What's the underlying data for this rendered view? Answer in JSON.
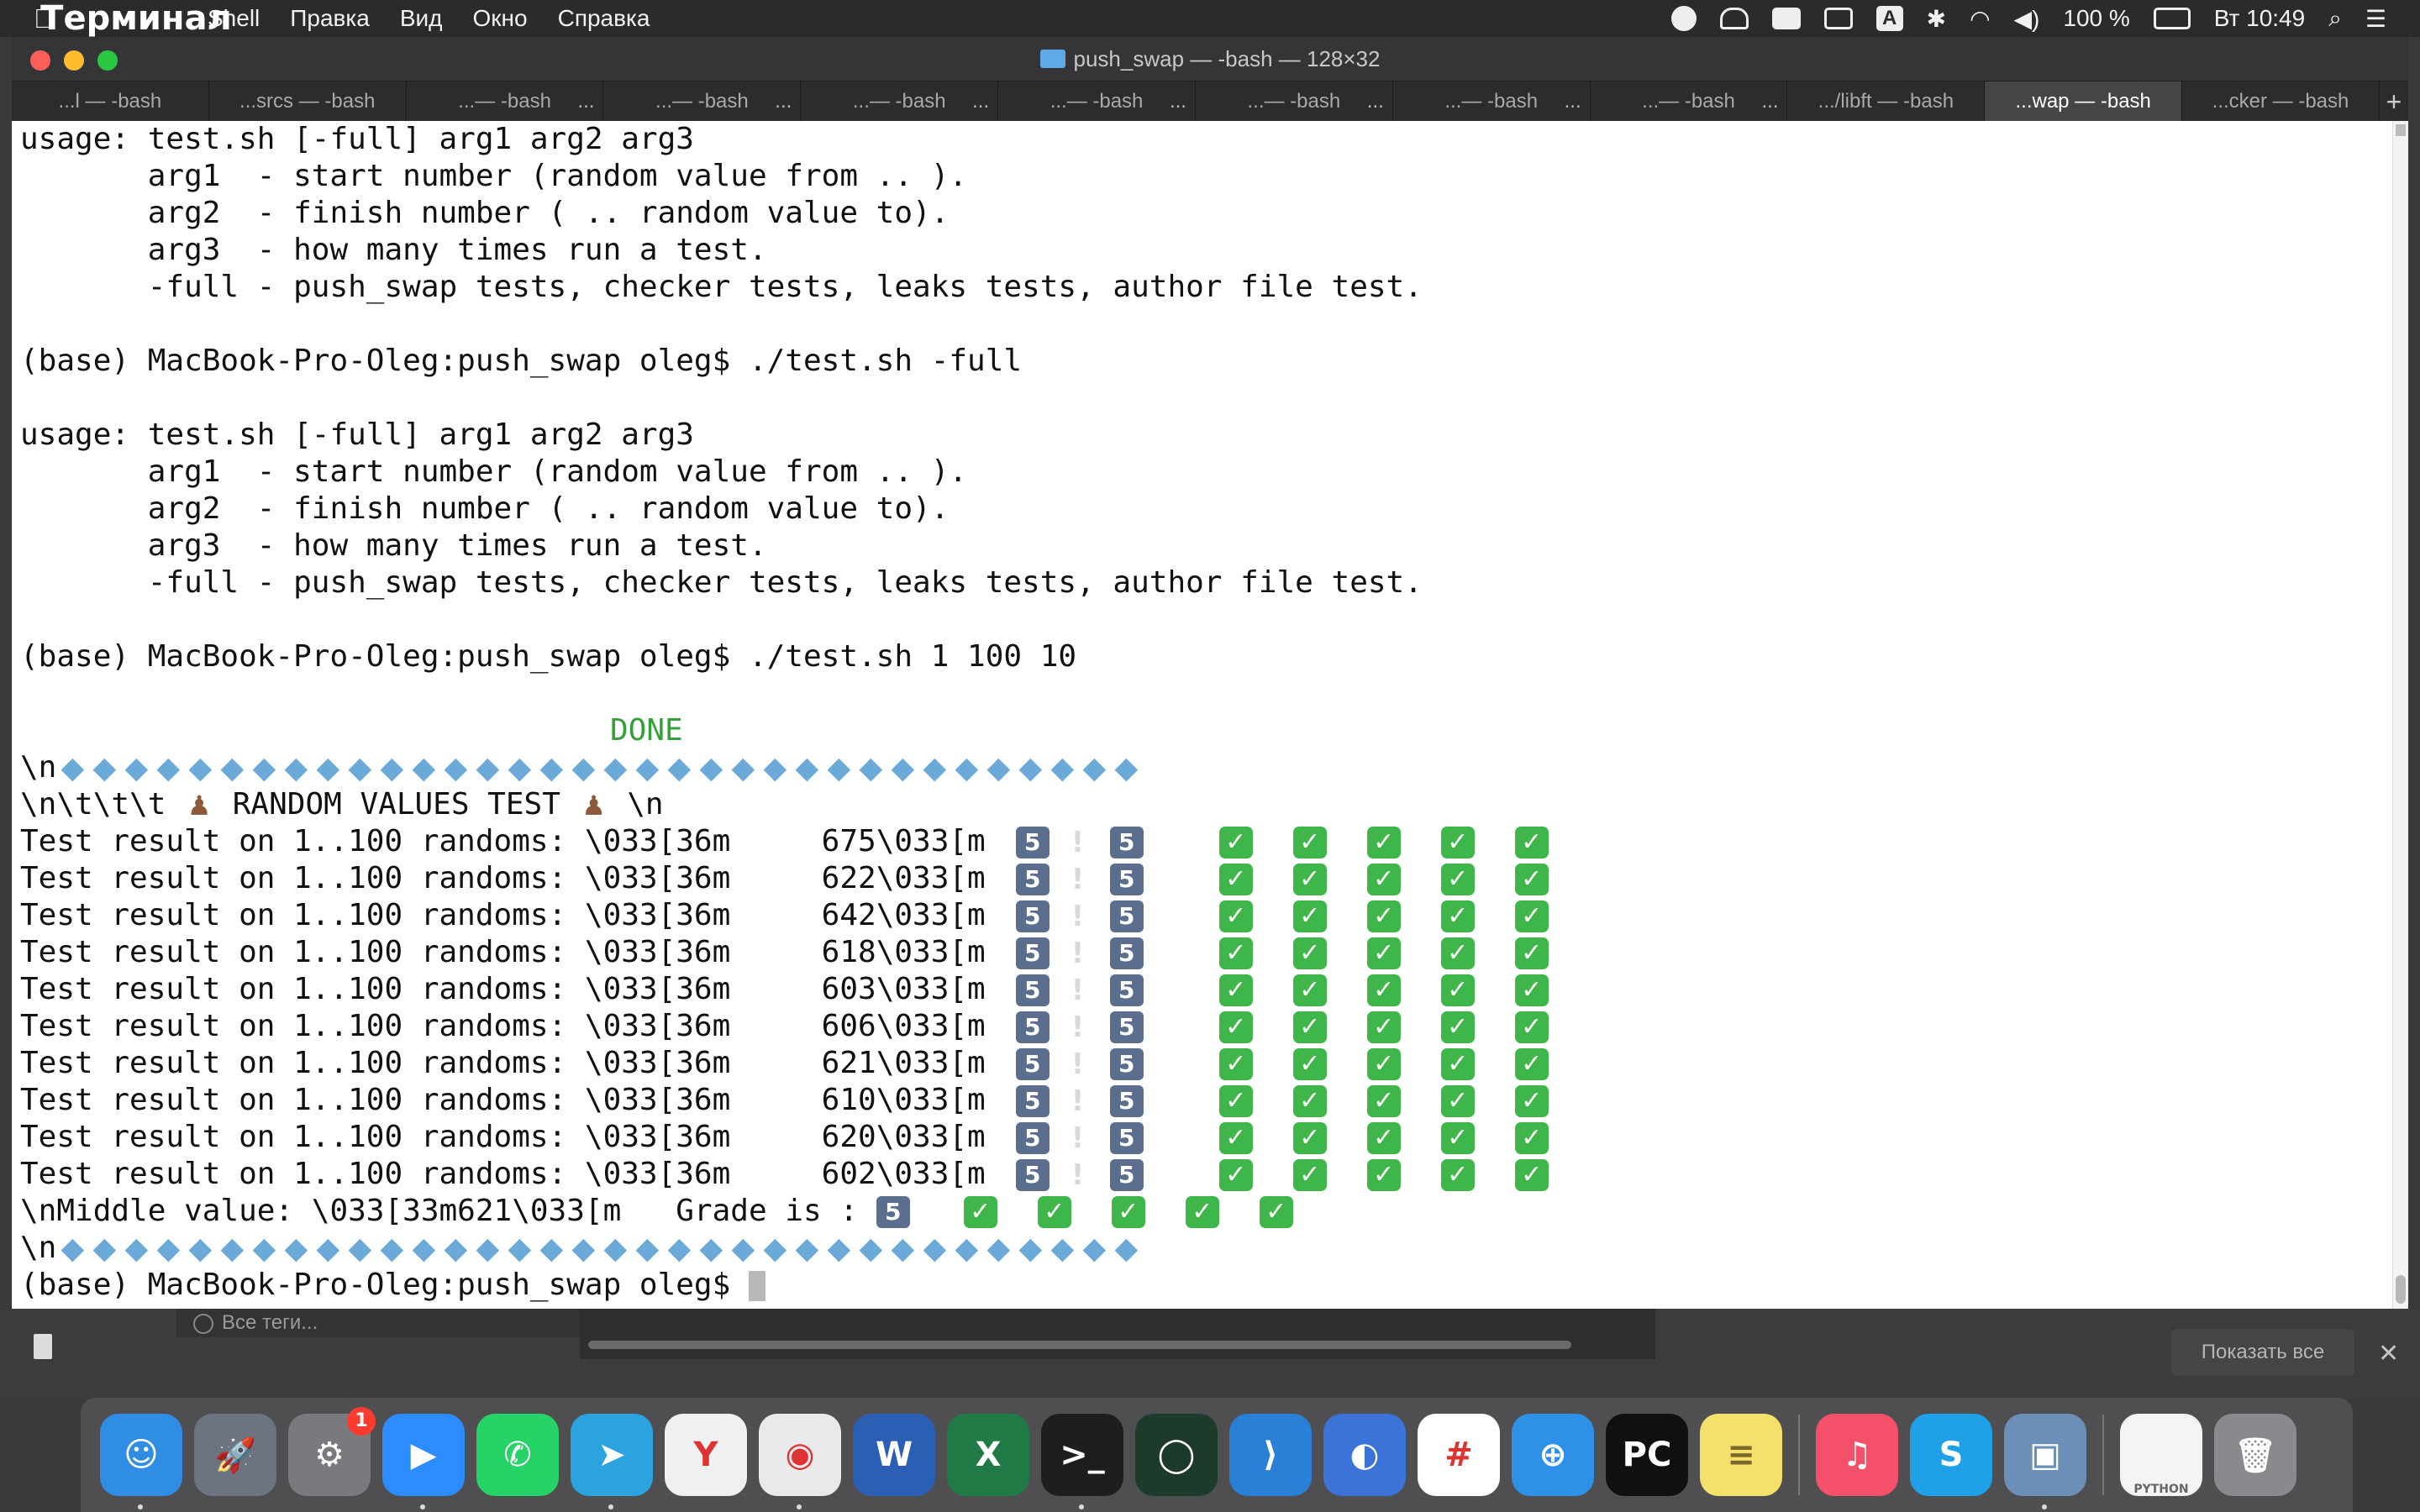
{
  "menubar": {
    "app_name": "Терминал",
    "items": [
      "Shell",
      "Правка",
      "Вид",
      "Окно",
      "Справка"
    ],
    "battery": "100 %",
    "clock": "Вт 10:49",
    "input_letter": "A"
  },
  "window": {
    "title": "push_swap — -bash — 128×32",
    "tabs": [
      {
        "label": "...l — -bash",
        "active": false
      },
      {
        "label": "...srcs — -bash",
        "active": false
      },
      {
        "label": "...— -bash",
        "active": false
      },
      {
        "label": "...— -bash",
        "active": false
      },
      {
        "label": "...— -bash",
        "active": false
      },
      {
        "label": "...— -bash",
        "active": false
      },
      {
        "label": "...— -bash",
        "active": false
      },
      {
        "label": "...— -bash",
        "active": false
      },
      {
        "label": "...— -bash",
        "active": false
      },
      {
        "label": ".../libft — -bash",
        "active": false
      },
      {
        "label": "...wap — -bash",
        "active": true
      },
      {
        "label": "...cker — -bash",
        "active": false
      }
    ],
    "tab_add": "+"
  },
  "terminal": {
    "usage_block": [
      "usage: test.sh [-full] arg1 arg2 arg3",
      "       arg1  - start number (random value from .. ).",
      "       arg2  - finish number ( .. random value to).",
      "       arg3  - how many times run a test.",
      "       -full - push_swap tests, checker tests, leaks tests, author file test."
    ],
    "prompt": "(base) MacBook-Pro-Oleg:push_swap oleg$ ",
    "cmd1": "./test.sh -full",
    "cmd2": "./test.sh 1 100 10",
    "done": "DONE",
    "separator_prefix": "\\n",
    "random_header_prefix": "\\n\\t\\t\\t ",
    "random_header_text": " RANDOM VALUES TEST ",
    "random_header_suffix": " \\n",
    "result_prefix": "Test result on 1..100 randoms: \\033[36m     ",
    "result_suffix": "\\033[m",
    "results": [
      "675",
      "622",
      "642",
      "618",
      "603",
      "606",
      "621",
      "610",
      "620",
      "602"
    ],
    "middle_prefix": "\\nMiddle value: \\033[33m",
    "middle_value": "621",
    "middle_suffix": "\\033[m   Grade is : ",
    "keycap": "5",
    "check": "✓",
    "excl": "!",
    "diamond": "◆",
    "spy": "♟"
  },
  "finder": {
    "tags_label": "Все теги...",
    "show_all": "Показать все",
    "close": "✕"
  },
  "dock": {
    "apps": [
      {
        "name": "finder",
        "glyph": "☺",
        "color": "#2f8de4",
        "running": true
      },
      {
        "name": "launchpad",
        "glyph": "🚀",
        "color": "#6d7380",
        "running": false
      },
      {
        "name": "system-preferences",
        "glyph": "⚙",
        "color": "#7a7a7e",
        "running": false,
        "badge": "1"
      },
      {
        "name": "zoom",
        "glyph": "▶",
        "color": "#2d8cff",
        "running": true
      },
      {
        "name": "whatsapp",
        "glyph": "✆",
        "color": "#25d366",
        "running": false
      },
      {
        "name": "telegram",
        "glyph": "➤",
        "color": "#2aa3df",
        "running": true
      },
      {
        "name": "yandex-browser",
        "glyph": "Y",
        "color": "#f0f0f0",
        "running": false
      },
      {
        "name": "chrome",
        "glyph": "◉",
        "color": "#e9e9e9",
        "running": true
      },
      {
        "name": "word",
        "glyph": "W",
        "color": "#2b5fb3",
        "running": false
      },
      {
        "name": "excel",
        "glyph": "X",
        "color": "#1f7a45",
        "running": false
      },
      {
        "name": "terminal",
        "glyph": ">_",
        "color": "#1e1e1e",
        "running": true
      },
      {
        "name": "pycharm-ring",
        "glyph": "◯",
        "color": "#1d3b2a",
        "running": false
      },
      {
        "name": "vscode",
        "glyph": "⟩",
        "color": "#2a7fd6",
        "running": false
      },
      {
        "name": "saucer",
        "glyph": "◐",
        "color": "#3b73d9",
        "running": false
      },
      {
        "name": "slack",
        "glyph": "#",
        "color": "#ffffff",
        "running": false
      },
      {
        "name": "safari",
        "glyph": "⊕",
        "color": "#2f90e8",
        "running": false
      },
      {
        "name": "pycharm",
        "glyph": "PC",
        "color": "#101010",
        "running": false
      },
      {
        "name": "notes",
        "glyph": "≡",
        "color": "#f5e06b",
        "running": false
      },
      {
        "name": "music",
        "glyph": "♫",
        "color": "#f55069",
        "running": false
      },
      {
        "name": "skype",
        "glyph": "S",
        "color": "#1ea1e6",
        "running": false
      },
      {
        "name": "preview",
        "glyph": "▣",
        "color": "#6c8fb8",
        "running": true
      }
    ],
    "doc_label": "PYTHON",
    "trash_glyph": "🗑"
  },
  "colors": {
    "terminal_bg": "#ffffff",
    "terminal_text": "#111111",
    "done_green": "#33a03a",
    "check_green": "#3fb64a"
  }
}
